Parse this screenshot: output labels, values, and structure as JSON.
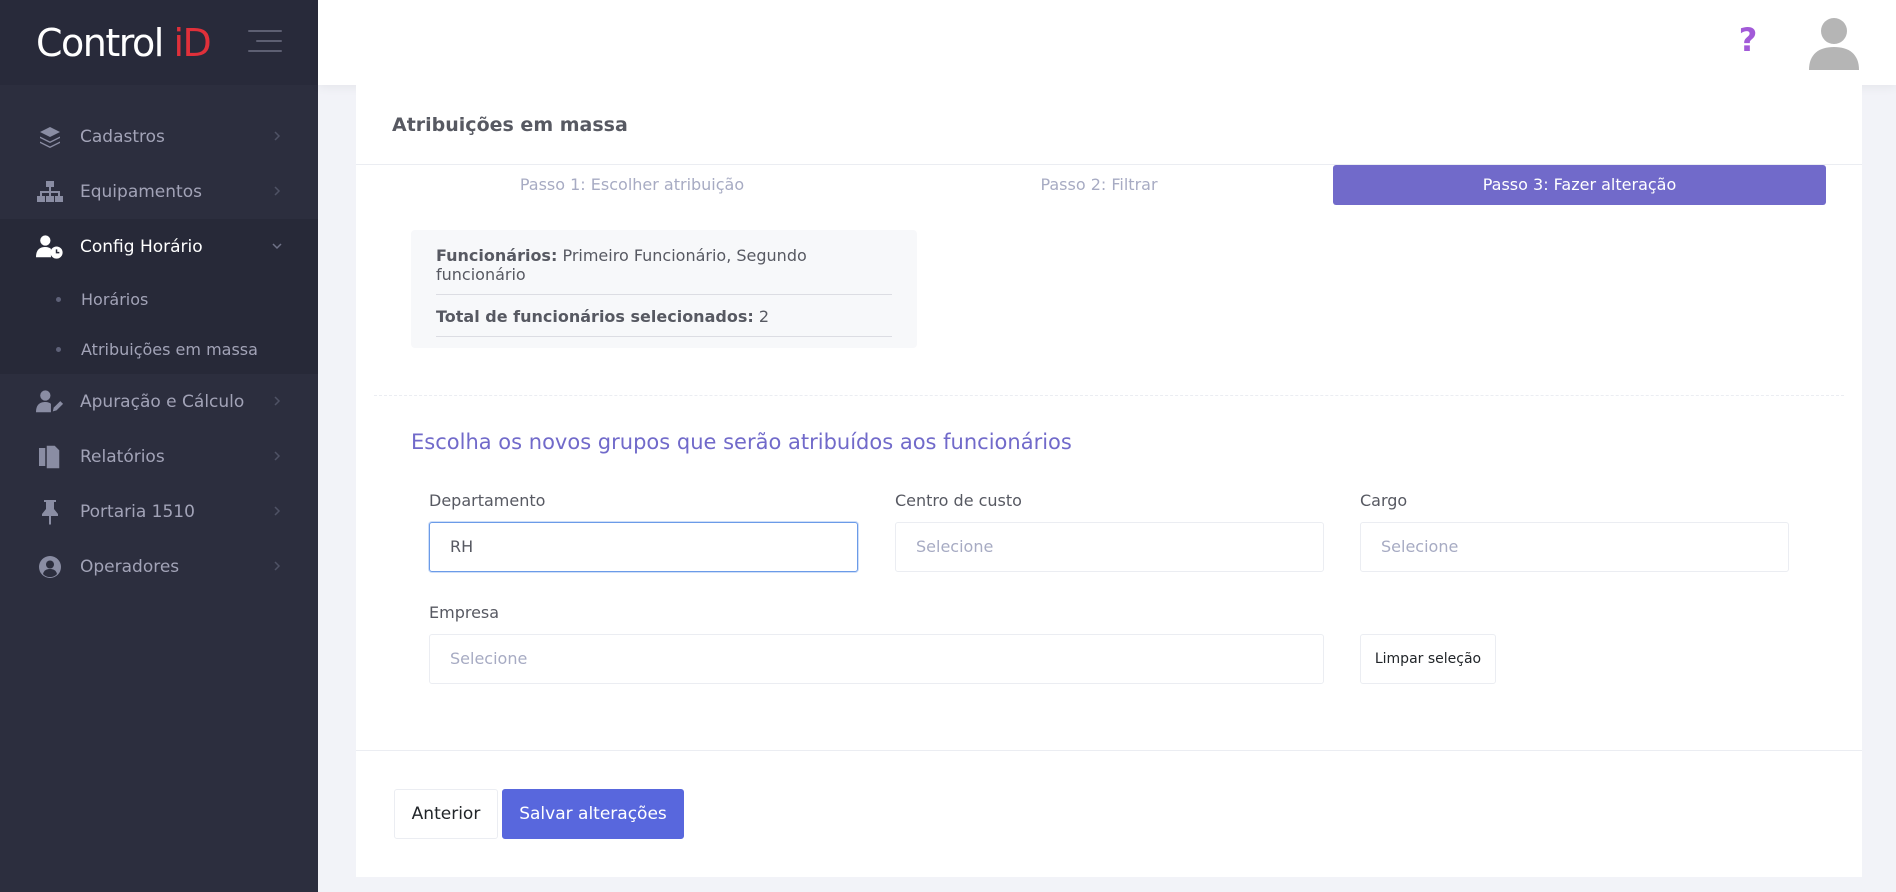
{
  "brand": {
    "name_part1": "Control ",
    "name_part2": "iD",
    "accent_color": "#e0303a"
  },
  "sidebar": {
    "items": [
      {
        "label": "Cadastros",
        "icon": "layers-icon"
      },
      {
        "label": "Equipamentos",
        "icon": "sitemap-icon"
      },
      {
        "label": "Config Horário",
        "icon": "user-clock-icon",
        "active": true
      },
      {
        "label": "Apuração e Cálculo",
        "icon": "user-edit-icon"
      },
      {
        "label": "Relatórios",
        "icon": "files-icon"
      },
      {
        "label": "Portaria 1510",
        "icon": "pin-icon"
      },
      {
        "label": "Operadores",
        "icon": "user-circle-icon"
      }
    ],
    "submenu": [
      {
        "label": "Horários"
      },
      {
        "label": "Atribuições em massa"
      }
    ]
  },
  "header": {
    "help": "?"
  },
  "page": {
    "title": "Atribuições em massa",
    "steps": [
      {
        "label": "Passo 1: Escolher atribuição"
      },
      {
        "label": "Passo 2: Filtrar"
      },
      {
        "label": "Passo 3: Fazer alteração",
        "active": true
      }
    ],
    "summary": {
      "employees_label": "Funcionários:",
      "employees_value": " Primeiro Funcionário, Segundo funcionário",
      "total_label": "Total de funcionários selecionados:",
      "total_value": " 2"
    },
    "section_title": "Escolha os novos grupos que serão atribuídos aos funcionários",
    "fields": {
      "departamento": {
        "label": "Departamento",
        "value": "RH"
      },
      "centro_custo": {
        "label": "Centro de custo",
        "placeholder": "Selecione"
      },
      "cargo": {
        "label": "Cargo",
        "placeholder": "Selecione"
      },
      "empresa": {
        "label": "Empresa",
        "placeholder": "Selecione"
      }
    },
    "clear_button": "Limpar seleção",
    "prev_button": "Anterior",
    "save_button": "Salvar alterações"
  },
  "colors": {
    "primary": "#716aca",
    "save": "#5867dd",
    "sidebar_bg": "#2c2e3e"
  }
}
